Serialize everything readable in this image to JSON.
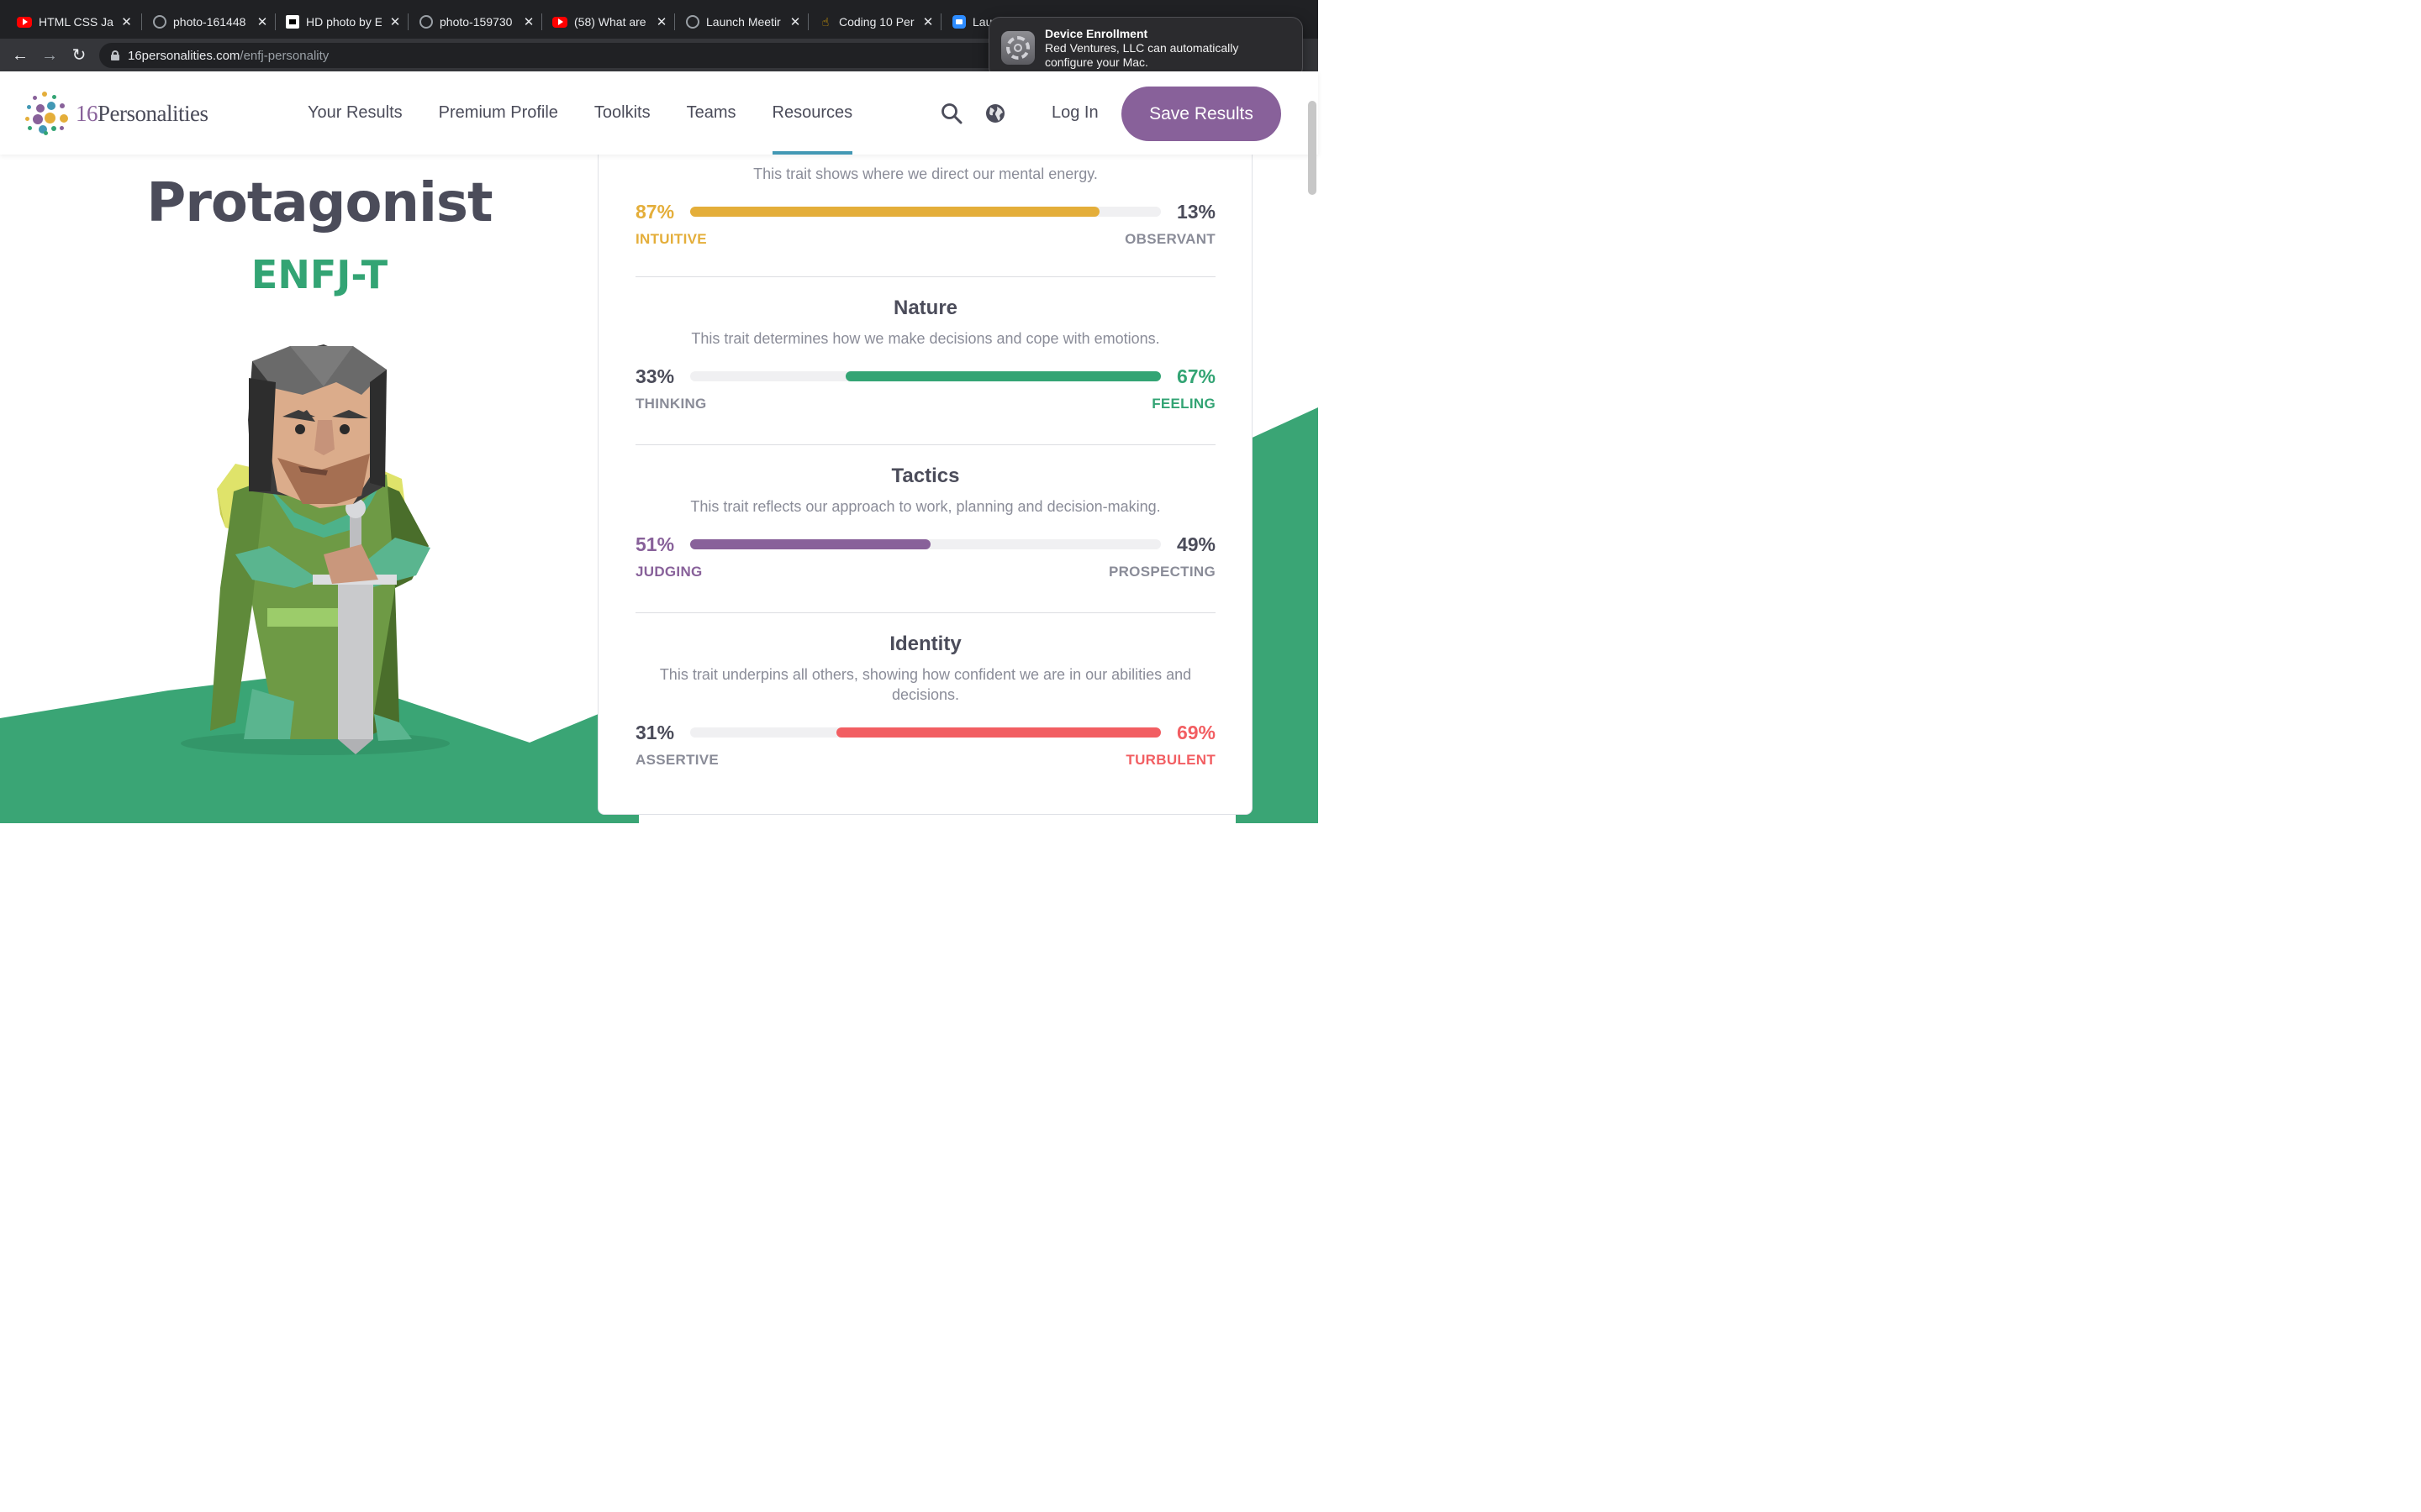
{
  "browser": {
    "tabs": [
      {
        "label": "HTML CSS Jav",
        "favicon": "youtube-icon"
      },
      {
        "label": "photo-161448",
        "favicon": "globe-icon"
      },
      {
        "label": "HD photo by E",
        "favicon": "unsplash-icon"
      },
      {
        "label": "photo-159730",
        "favicon": "globe-icon"
      },
      {
        "label": "(58) What are",
        "favicon": "youtube-icon"
      },
      {
        "label": "Launch Meetir",
        "favicon": "globe-icon"
      },
      {
        "label": "Coding 10 Per",
        "favicon": "hand-icon"
      },
      {
        "label": "Lau",
        "favicon": "zoom-icon"
      }
    ],
    "url_domain": "16personalities.com",
    "url_path": "/enfj-personality"
  },
  "notification": {
    "title": "Device Enrollment",
    "body_line1": "Red Ventures, LLC can automatically",
    "body_line2": "configure your Mac."
  },
  "header": {
    "logo_number": "16",
    "logo_word": "Personalities",
    "nav": [
      "Your Results",
      "Premium Profile",
      "Toolkits",
      "Teams",
      "Resources"
    ],
    "active_nav": "Resources",
    "login_label": "Log In",
    "save_label": "Save Results"
  },
  "profile": {
    "type_name": "Protagonist",
    "type_code": "ENFJ-T"
  },
  "traits": [
    {
      "title": "",
      "description": "This trait shows where we direct our mental energy.",
      "left_pct": "87%",
      "right_pct": "13%",
      "left_label": "INTUITIVE",
      "right_label": "OBSERVANT",
      "dominant": "left",
      "value": 0.87,
      "color": "#e4ae3a"
    },
    {
      "title": "Nature",
      "description": "This trait determines how we make decisions and cope with emotions.",
      "left_pct": "33%",
      "right_pct": "67%",
      "left_label": "THINKING",
      "right_label": "FEELING",
      "dominant": "right",
      "value": 0.67,
      "color": "#33a474"
    },
    {
      "title": "Tactics",
      "description": "This trait reflects our approach to work, planning and decision-making.",
      "left_pct": "51%",
      "right_pct": "49%",
      "left_label": "JUDGING",
      "right_label": "PROSPECTING",
      "dominant": "left",
      "value": 0.51,
      "color": "#88619a"
    },
    {
      "title": "Identity",
      "description": "This trait underpins all others, showing how confident we are in our abilities and decisions.",
      "left_pct": "31%",
      "right_pct": "69%",
      "left_label": "ASSERTIVE",
      "right_label": "TURBULENT",
      "dominant": "right",
      "value": 0.69,
      "color": "#f25e62"
    }
  ],
  "colors": {
    "brand_purple": "#88619a",
    "hill_green": "#3aa575",
    "text_dark": "#4b4c5a",
    "active_underline": "#4298b4"
  }
}
